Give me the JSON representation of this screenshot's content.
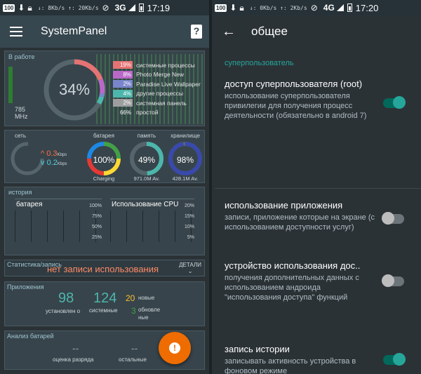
{
  "left_status": {
    "speed": "↓: 8Kb/s  ↑: 20Kb/s",
    "network": "3G",
    "network_sup": "3G",
    "time": "17:19",
    "badge": "100"
  },
  "right_status": {
    "speed": "↓: 0Kb/s  ↑: 2Kb/s",
    "network": "4G",
    "network_sup": "4G",
    "time": "17:20",
    "badge": "100"
  },
  "left_app": {
    "title": "SystemPanel",
    "help": "?"
  },
  "right_app": {
    "title": "общее"
  },
  "working": {
    "label": "В работе",
    "freq": "785",
    "freq_unit": "MHz",
    "cpu_percent": "34%",
    "processes": [
      {
        "pct": "19%",
        "name": "системные процессы",
        "color": "#e57373"
      },
      {
        "pct": "8%",
        "name": "Photo Merge New",
        "color": "#ba68c8"
      },
      {
        "pct": "2%",
        "name": "Paradise Live Wallpaper",
        "color": "#7986cb"
      },
      {
        "pct": "4%",
        "name": "другие процессы",
        "color": "#4db6ac"
      },
      {
        "pct": "2%",
        "name": "системная панель",
        "color": "#9e9e9e"
      },
      {
        "pct": "66%",
        "name": "простой",
        "color": "transparent"
      }
    ]
  },
  "gauges": {
    "net_label": "сеть",
    "up": "0.3",
    "down": "0.2",
    "unit": "Kbps",
    "battery_label": "батарея",
    "battery_val": "100%",
    "battery_sub": "Charging",
    "memory_label": "память",
    "memory_val": "49%",
    "memory_sub": "971.0M Av.",
    "storage_label": "хранилище",
    "storage_val": "98%",
    "storage_sub": "428.1M Av."
  },
  "history": {
    "label": "история",
    "battery_title": "батарея",
    "battery_ticks": [
      "100%",
      "75%",
      "50%",
      "25%"
    ],
    "cpu_title": "Использование CPU",
    "cpu_ticks": [
      "20%",
      "15%",
      "10%",
      "5%"
    ]
  },
  "stats": {
    "label": "Статистика/запись",
    "main": "нет записи использования",
    "details": "ДЕТАЛИ"
  },
  "apps": {
    "label": "Приложения",
    "installed": "98",
    "installed_label": "установлен о",
    "system": "124",
    "system_label": "системные",
    "new_count": "20",
    "new_label": "новые",
    "updated_count": "3",
    "updated_label": "обновле ные"
  },
  "battery_analysis": {
    "label": "Анализ батарей",
    "rating": "--",
    "rating_label": "оценка разряда",
    "remaining": "--",
    "remaining_label": "остальные"
  },
  "fab_icon": "!",
  "settings": {
    "section": "суперпользователь",
    "items": [
      {
        "title": "доступ суперпользователя (root)",
        "summary": "использование суперпользователя привилегии для получения процесс деятельности (обязательно в android 7)",
        "on": true
      },
      {
        "title": "использование приложения",
        "summary": "записи, приложение которые на экране (с использованием доступности услуг)",
        "on": false
      },
      {
        "title": "устройство использования дос..",
        "summary": "получения дополнительных данных с использованием андроида \"использования доступа\" функций",
        "on": false
      },
      {
        "title": "запись истории",
        "summary": "записывать активность устройства в фоновом режиме",
        "on": true
      }
    ]
  }
}
